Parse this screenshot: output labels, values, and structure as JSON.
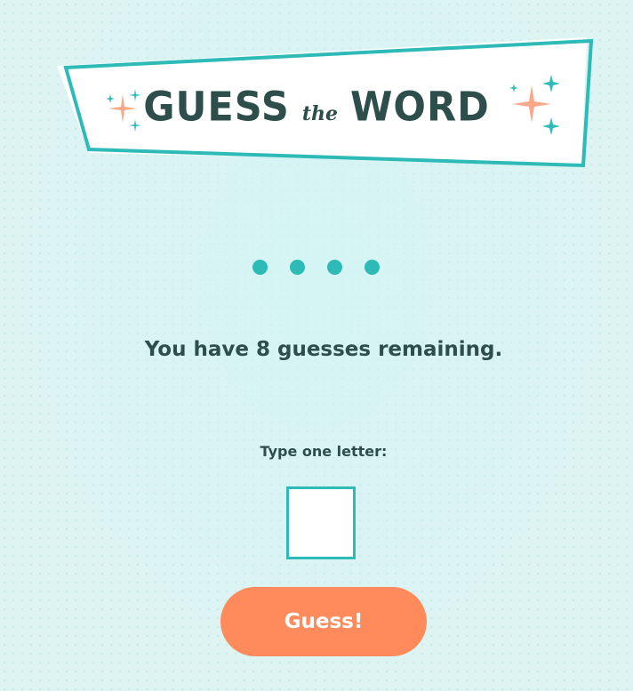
{
  "header": {
    "title_word_1": "GUESS",
    "title_connector": "the",
    "title_word_2": "WORD"
  },
  "word_placeholder": {
    "hidden_letter_count": 4,
    "slots": [
      "●",
      "●",
      "●",
      "●"
    ]
  },
  "status": {
    "remaining_message": "You have 8 guesses remaining.",
    "guesses_remaining": 8
  },
  "input": {
    "label": "Type one letter:",
    "value": "",
    "maxlength": "1"
  },
  "guess_button": {
    "label": "Guess!"
  },
  "colors": {
    "background": "#ddf4f3",
    "teal_accent": "#2ebab7",
    "dark_text": "#2e4e4c",
    "sparkle_salmon": "#f9a98a",
    "button_orange": "#ff8a5b",
    "white": "#ffffff"
  },
  "icons": {
    "banner_left": "sparkle-cluster-icon",
    "banner_right": "sparkle-cluster-icon"
  }
}
